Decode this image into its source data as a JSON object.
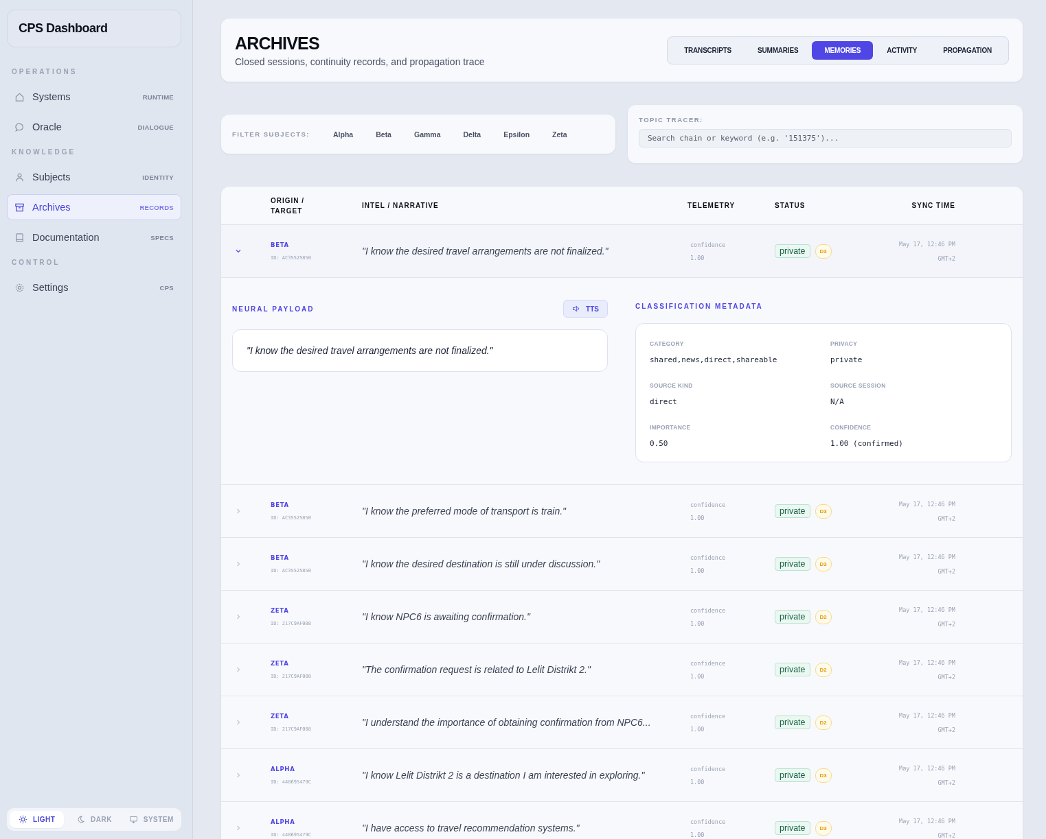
{
  "sidebar": {
    "brand": "CPS Dashboard",
    "sections": [
      {
        "title": "OPERATIONS",
        "items": [
          {
            "label": "Systems",
            "tag": "RUNTIME",
            "selected": false
          },
          {
            "label": "Oracle",
            "tag": "DIALOGUE",
            "selected": false
          }
        ]
      },
      {
        "title": "KNOWLEDGE",
        "items": [
          {
            "label": "Subjects",
            "tag": "IDENTITY",
            "selected": false
          },
          {
            "label": "Archives",
            "tag": "RECORDS",
            "selected": true
          },
          {
            "label": "Documentation",
            "tag": "SPECS",
            "selected": false
          }
        ]
      },
      {
        "title": "CONTROL",
        "items": [
          {
            "label": "Settings",
            "tag": "CPS",
            "selected": false
          }
        ]
      }
    ],
    "theme": [
      {
        "label": "LIGHT",
        "selected": true
      },
      {
        "label": "DARK",
        "selected": false
      },
      {
        "label": "SYSTEM",
        "selected": false
      }
    ]
  },
  "header": {
    "title": "ARCHIVES",
    "subtitle": "Closed sessions, continuity records, and propagation trace",
    "tabs": [
      {
        "label": "TRANSCRIPTS",
        "selected": false
      },
      {
        "label": "SUMMARIES",
        "selected": false
      },
      {
        "label": "MEMORIES",
        "selected": true
      },
      {
        "label": "ACTIVITY",
        "selected": false
      },
      {
        "label": "PROPAGATION",
        "selected": false
      }
    ]
  },
  "filter": {
    "label": "FILTER SUBJECTS:",
    "subjects": [
      "Alpha",
      "Beta",
      "Gamma",
      "Delta",
      "Epsilon",
      "Zeta"
    ]
  },
  "tracer": {
    "label": "TOPIC TRACER:",
    "placeholder": "Search chain or keyword (e.g. '151375')..."
  },
  "table": {
    "columns": [
      "ORIGIN / TARGET",
      "INTEL / NARRATIVE",
      "TELEMETRY",
      "STATUS",
      "SYNC TIME"
    ],
    "rows": [
      {
        "expanded": true,
        "origin": "BETA",
        "id": "ID: AC35525850",
        "text": "\"I know the desired travel arrangements are not finalized.\"",
        "metric": "confidence",
        "value": "1.00",
        "status": "private",
        "level": "D3",
        "time": "May 17, 12:46 PM",
        "tz": "GMT+2",
        "detail": {
          "payload_label": "NEURAL PAYLOAD",
          "tts": "TTS",
          "payload": "\"I know the desired travel arrangements are not finalized.\"",
          "meta_label": "CLASSIFICATION METADATA",
          "fields": [
            {
              "label": "CATEGORY",
              "value": "shared,news,direct,shareable"
            },
            {
              "label": "PRIVACY",
              "value": "private"
            },
            {
              "label": "SOURCE KIND",
              "value": "direct"
            },
            {
              "label": "SOURCE SESSION",
              "value": "N/A"
            },
            {
              "label": "IMPORTANCE",
              "value": "0.50"
            },
            {
              "label": "CONFIDENCE",
              "value": "1.00 (confirmed)"
            }
          ]
        }
      },
      {
        "expanded": false,
        "origin": "BETA",
        "id": "ID: AC35525850",
        "text": "\"I know the preferred mode of transport is train.\"",
        "metric": "confidence",
        "value": "1.00",
        "status": "private",
        "level": "D3",
        "time": "May 17, 12:46 PM",
        "tz": "GMT+2"
      },
      {
        "expanded": false,
        "origin": "BETA",
        "id": "ID: AC35525850",
        "text": "\"I know the desired destination is still under discussion.\"",
        "metric": "confidence",
        "value": "1.00",
        "status": "private",
        "level": "D3",
        "time": "May 17, 12:46 PM",
        "tz": "GMT+2"
      },
      {
        "expanded": false,
        "origin": "ZETA",
        "id": "ID: 217C9AF008",
        "text": "\"I know NPC6 is awaiting confirmation.\"",
        "metric": "confidence",
        "value": "1.00",
        "status": "private",
        "level": "D2",
        "time": "May 17, 12:46 PM",
        "tz": "GMT+2"
      },
      {
        "expanded": false,
        "origin": "ZETA",
        "id": "ID: 217C9AF008",
        "text": "\"The confirmation request is related to Lelit Distrikt 2.\"",
        "metric": "confidence",
        "value": "1.00",
        "status": "private",
        "level": "D2",
        "time": "May 17, 12:46 PM",
        "tz": "GMT+2"
      },
      {
        "expanded": false,
        "origin": "ZETA",
        "id": "ID: 217C9AF008",
        "text": "\"I understand the importance of obtaining confirmation from NPC6...",
        "metric": "confidence",
        "value": "1.00",
        "status": "private",
        "level": "D2",
        "time": "May 17, 12:46 PM",
        "tz": "GMT+2"
      },
      {
        "expanded": false,
        "origin": "ALPHA",
        "id": "ID: 448695479C",
        "text": "\"I know Lelit Distrikt 2 is a destination I am interested in exploring.\"",
        "metric": "confidence",
        "value": "1.00",
        "status": "private",
        "level": "D3",
        "time": "May 17, 12:46 PM",
        "tz": "GMT+2"
      },
      {
        "expanded": false,
        "origin": "ALPHA",
        "id": "ID: 448695479C",
        "text": "\"I have access to travel recommendation systems.\"",
        "metric": "confidence",
        "value": "1.00",
        "status": "private",
        "level": "D3",
        "time": "May 17, 12:46 PM",
        "tz": "GMT+2"
      }
    ]
  }
}
